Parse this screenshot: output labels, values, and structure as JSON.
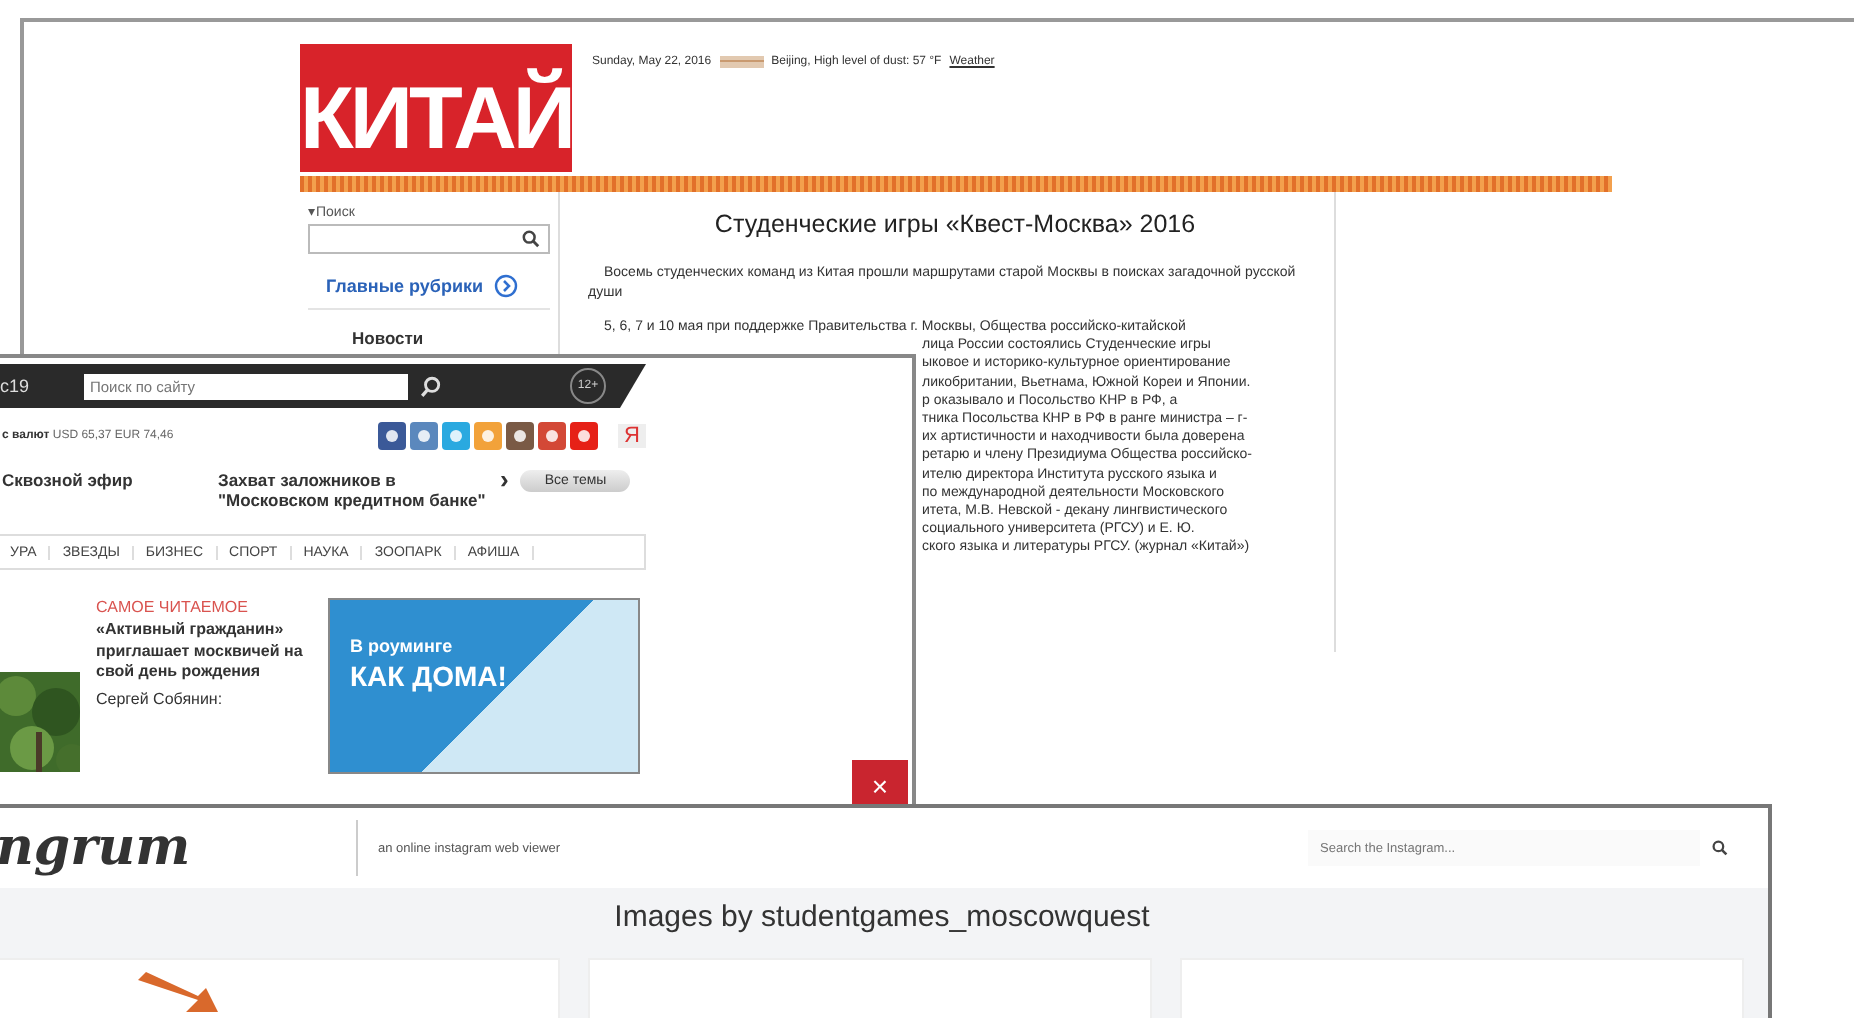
{
  "kitai_page": {
    "logo": "КИТАЙ",
    "date": "Sunday, May 22, 2016",
    "weather": "Beijing, High level of dust: 57 °F",
    "weather_link": "Weather",
    "sidebar": {
      "search_label": "▾Поиск",
      "rubrics": "Главные рубрики",
      "items": [
        "Новости"
      ]
    },
    "article": {
      "title": "Студенческие игры «Квест-Москва» 2016",
      "lead": "Восемь студенческих команд из Китая прошли маршрутами старой Москвы в поисках загадочной русской души",
      "lines": [
        "5, 6, 7 и 10 мая при поддержке Правительства г. Москвы, Общества российско-китайской",
        "лица России состоялись Студенческие игры",
        "ыковое и историко-культурное ориентирование",
        "ликобритании, Вьетнама, Южной Кореи и Японии.",
        "р оказывало и Посольство КНР в РФ, а",
        "тника Посольства КНР в РФ в ранге министра – г-",
        "их артистичности и находчивости была доверена",
        "ретарю и члену Президиума Общества российско-",
        "ителю директора Института русского языка и",
        "по международной деятельности Московского",
        "итета, М.В. Невской - декану лингвистического",
        "социального университета (РГСУ) и Е. Ю.",
        "ского языка и литературы РГСУ. (журнал «Китай»)"
      ]
    }
  },
  "news_page": {
    "logo": "с19",
    "search": {
      "placeholder": "Поиск по сайту"
    },
    "age": "12+",
    "currency_label": "с валют",
    "currency": "USD 65,37 EUR 74,46",
    "social": [
      {
        "kind": "facebook"
      },
      {
        "kind": "vk"
      },
      {
        "kind": "twitter"
      },
      {
        "kind": "ok"
      },
      {
        "kind": "instagram"
      },
      {
        "kind": "gplus"
      },
      {
        "kind": "youtube"
      }
    ],
    "yandex": "Я",
    "live": "Сквозной эфир",
    "headline": "Захват заложников в \"Московском кредитном банке\"",
    "next": "›",
    "all_topics": "Все темы",
    "nav": [
      "УРА",
      "ЗВЕЗДЫ",
      "БИЗНЕС",
      "СПОРТ",
      "НАУКА",
      "ЗООПАРК",
      "АФИША"
    ],
    "most_read": {
      "heading": "САМОЕ ЧИТАЕМОЕ",
      "story": "«Активный гражданин» приглашает москвичей на свой день рождения",
      "author": "Сергей Собянин:"
    },
    "ad": {
      "line1": "В роуминге",
      "line2": "КАК ДОМА!"
    },
    "close": "×"
  },
  "insta_page": {
    "logo": "ngrum",
    "tagline": "an online instagram web viewer",
    "search": {
      "placeholder": "Search the Instagram..."
    },
    "title": "Images by studentgames_moscowquest"
  }
}
